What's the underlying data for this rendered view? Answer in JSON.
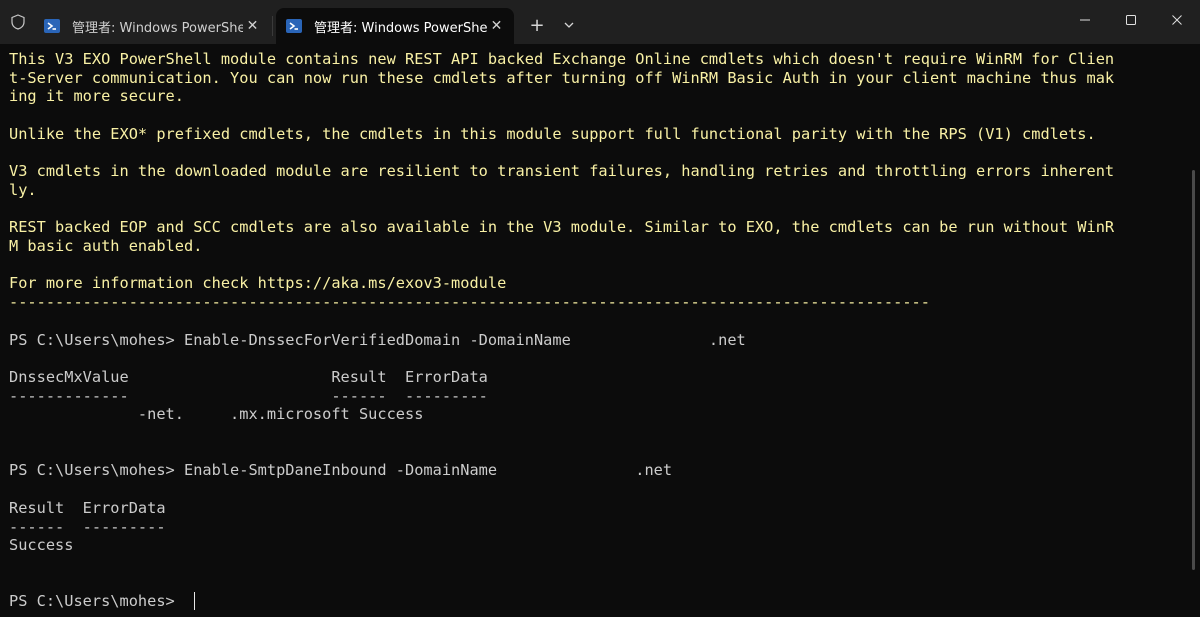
{
  "window": {
    "tabs": [
      {
        "label": "管理者: Windows PowerShell",
        "active": false
      },
      {
        "label": "管理者: Windows PowerShell",
        "active": true
      }
    ],
    "new_tab_symbol": "+",
    "dropdown_icon": "chevron-down-icon",
    "controls": {
      "minimize": "—",
      "maximize": "☐",
      "close": "✕"
    }
  },
  "colors": {
    "background": "#0c0c0c",
    "titlebar": "#202020",
    "banner_text": "#f9f1a5",
    "normal_text": "#cccccc"
  },
  "terminal": {
    "banner_lines": [
      "This V3 EXO PowerShell module contains new REST API backed Exchange Online cmdlets which doesn't require WinRM for Clien",
      "t-Server communication. You can now run these cmdlets after turning off WinRM Basic Auth in your client machine thus mak",
      "ing it more secure.",
      "",
      "Unlike the EXO* prefixed cmdlets, the cmdlets in this module support full functional parity with the RPS (V1) cmdlets.",
      "",
      "V3 cmdlets in the downloaded module are resilient to transient failures, handling retries and throttling errors inherent",
      "ly.",
      "",
      "REST backed EOP and SCC cmdlets are also available in the V3 module. Similar to EXO, the cmdlets can be run without WinR",
      "M basic auth enabled.",
      "",
      "For more information check https://aka.ms/exov3-module",
      "----------------------------------------------------------------------------------------------------"
    ],
    "output_lines": [
      "",
      "PS C:\\Users\\mohes> Enable-DnssecForVerifiedDomain -DomainName               .net",
      "",
      "DnssecMxValue                      Result  ErrorData",
      "-------------                      ------  ---------",
      "              -net.     .mx.microsoft Success",
      "",
      "",
      "PS C:\\Users\\mohes> Enable-SmtpDaneInbound -DomainName               .net",
      "",
      "Result  ErrorData",
      "------  ---------",
      "Success",
      "",
      "",
      "PS C:\\Users\\mohes> "
    ]
  }
}
